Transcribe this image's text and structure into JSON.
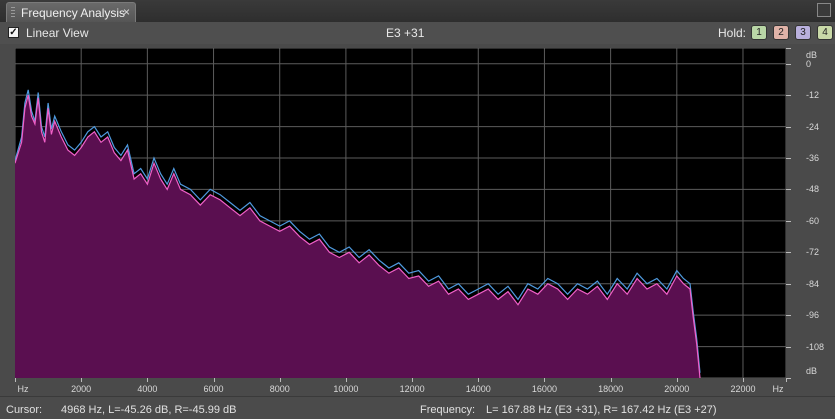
{
  "panel": {
    "tab_title": "Frequency Analysis",
    "tab_close": "×"
  },
  "toolbar": {
    "linear_view_checked": true,
    "linear_view_label": "Linear View",
    "pitch_readout": "E3 +31",
    "hold_label": "Hold:",
    "hold_buttons": [
      {
        "label": "1",
        "color": "#b9d6a6"
      },
      {
        "label": "2",
        "color": "#e0b3a8"
      },
      {
        "label": "3",
        "color": "#b9b0dd"
      },
      {
        "label": "4",
        "color": "#c9d9a8"
      }
    ]
  },
  "chart_data": {
    "type": "area",
    "xlabel": "Hz",
    "ylabel": "dB",
    "x_ticks": [
      "Hz",
      "2000",
      "4000",
      "6000",
      "8000",
      "10000",
      "12000",
      "14000",
      "16000",
      "18000",
      "20000",
      "22000",
      "Hz"
    ],
    "y_ticks": [
      "dB",
      "0",
      "-12",
      "-24",
      "-36",
      "-48",
      "-60",
      "-72",
      "-84",
      "-96",
      "-108",
      "dB"
    ],
    "xlim": [
      0,
      23300
    ],
    "ylim": [
      -120,
      6
    ],
    "grid": true,
    "colors": {
      "left_channel": "#4f9be0",
      "right_channel": "#f060c8",
      "fill": "#5a0f50",
      "background": "#000000",
      "grid": "#5c5c5c"
    },
    "series": [
      {
        "channel": "L",
        "x": [
          0,
          200,
          300,
          400,
          500,
          600,
          700,
          800,
          900,
          1000,
          1100,
          1200,
          1400,
          1600,
          1800,
          2000,
          2200,
          2400,
          2600,
          2800,
          3000,
          3200,
          3400,
          3600,
          3800,
          4000,
          4200,
          4400,
          4600,
          4800,
          5000,
          5300,
          5600,
          5900,
          6200,
          6500,
          6800,
          7100,
          7400,
          7700,
          8000,
          8300,
          8600,
          8900,
          9200,
          9500,
          9800,
          10100,
          10400,
          10700,
          11000,
          11300,
          11600,
          11900,
          12200,
          12500,
          12800,
          13100,
          13400,
          13700,
          14000,
          14300,
          14600,
          14900,
          15200,
          15500,
          15800,
          16100,
          16400,
          16700,
          17000,
          17300,
          17600,
          17900,
          18200,
          18500,
          18800,
          19100,
          19400,
          19700,
          20000,
          20200,
          20400,
          20500,
          20600,
          20700
        ],
        "y": [
          -37,
          -28,
          -15,
          -10,
          -18,
          -22,
          -11,
          -24,
          -28,
          -15,
          -25,
          -20,
          -26,
          -31,
          -33,
          -30,
          -26,
          -24,
          -28,
          -26,
          -32,
          -35,
          -31,
          -42,
          -40,
          -44,
          -36,
          -42,
          -46,
          -40,
          -46,
          -48,
          -52,
          -48,
          -50,
          -53,
          -56,
          -53,
          -58,
          -60,
          -62,
          -60,
          -64,
          -67,
          -65,
          -70,
          -72,
          -70,
          -74,
          -71,
          -75,
          -78,
          -76,
          -80,
          -79,
          -83,
          -81,
          -86,
          -84,
          -88,
          -86,
          -84,
          -88,
          -85,
          -90,
          -84,
          -86,
          -82,
          -84,
          -88,
          -84,
          -86,
          -83,
          -88,
          -82,
          -86,
          -80,
          -84,
          -82,
          -86,
          -79,
          -82,
          -84,
          -95,
          -105,
          -118
        ]
      },
      {
        "channel": "R",
        "x": [
          0,
          200,
          300,
          400,
          500,
          600,
          700,
          800,
          900,
          1000,
          1100,
          1200,
          1400,
          1600,
          1800,
          2000,
          2200,
          2400,
          2600,
          2800,
          3000,
          3200,
          3400,
          3600,
          3800,
          4000,
          4200,
          4400,
          4600,
          4800,
          5000,
          5300,
          5600,
          5900,
          6200,
          6500,
          6800,
          7100,
          7400,
          7700,
          8000,
          8300,
          8600,
          8900,
          9200,
          9500,
          9800,
          10100,
          10400,
          10700,
          11000,
          11300,
          11600,
          11900,
          12200,
          12500,
          12800,
          13100,
          13400,
          13700,
          14000,
          14300,
          14600,
          14900,
          15200,
          15500,
          15800,
          16100,
          16400,
          16700,
          17000,
          17300,
          17600,
          17900,
          18200,
          18500,
          18800,
          19100,
          19400,
          19700,
          20000,
          20200,
          20400,
          20500,
          20600,
          20700
        ],
        "y": [
          -38,
          -30,
          -17,
          -12,
          -20,
          -23,
          -13,
          -26,
          -30,
          -17,
          -27,
          -22,
          -28,
          -33,
          -35,
          -32,
          -28,
          -26,
          -30,
          -28,
          -34,
          -37,
          -33,
          -44,
          -42,
          -46,
          -38,
          -44,
          -48,
          -42,
          -48,
          -50,
          -54,
          -50,
          -52,
          -55,
          -58,
          -55,
          -60,
          -62,
          -64,
          -62,
          -66,
          -69,
          -67,
          -72,
          -74,
          -72,
          -76,
          -73,
          -77,
          -80,
          -78,
          -82,
          -81,
          -85,
          -83,
          -88,
          -86,
          -90,
          -88,
          -86,
          -90,
          -87,
          -92,
          -86,
          -88,
          -84,
          -86,
          -90,
          -86,
          -88,
          -85,
          -90,
          -84,
          -88,
          -82,
          -86,
          -84,
          -88,
          -81,
          -84,
          -86,
          -97,
          -107,
          -120
        ]
      }
    ]
  },
  "status": {
    "cursor_label": "Cursor:",
    "cursor_value": "4968 Hz, L=-45.26 dB, R=-45.99 dB",
    "frequency_label": "Frequency:",
    "frequency_value": "L= 167.88 Hz (E3 +31), R= 167.42 Hz (E3 +27)"
  }
}
